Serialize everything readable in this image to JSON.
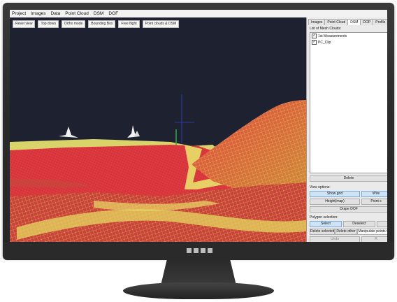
{
  "menu": [
    "Project",
    "Images",
    "Data",
    "Point Cloud",
    "DSM",
    "DOF"
  ],
  "viewport_toolbar": [
    "Reset view",
    "Top down",
    "Ortho mode",
    "Bounding Box",
    "Free flight",
    "Point clouds & DSM"
  ],
  "panel": {
    "tabs": [
      "Images",
      "Point Cloud",
      "DSM",
      "DOP",
      "Profile"
    ],
    "active_tab": "DSM",
    "list_label": "List of Mesh Clouds:",
    "items": [
      {
        "label": "1st Measurements",
        "checked": true
      },
      {
        "label": "PC_Clip",
        "checked": true
      }
    ],
    "delete_label": "Delete",
    "view_options_label": "View options:",
    "show_grid_label": "Show grid",
    "wireframe_label": "Wire",
    "heightmap_label": "Height(map)",
    "point_label": "Point s",
    "drape_dof_label": "Drape DOF",
    "polygon_selection_label": "Polygon selection:",
    "select_label": "Select",
    "deselect_label": "Deselect",
    "delete_selected_label": "Delete selected",
    "delete_other_label": "Delete other",
    "manipulate_points_label": "Manipulate points ▾",
    "undo_label": "Undo",
    "redo_label": "R"
  },
  "colors": {
    "sky": "#1d2130",
    "terrain_red": "#d8323a",
    "terrain_yellow": "#e8e06a",
    "button_blue": "#cfe3f7"
  }
}
